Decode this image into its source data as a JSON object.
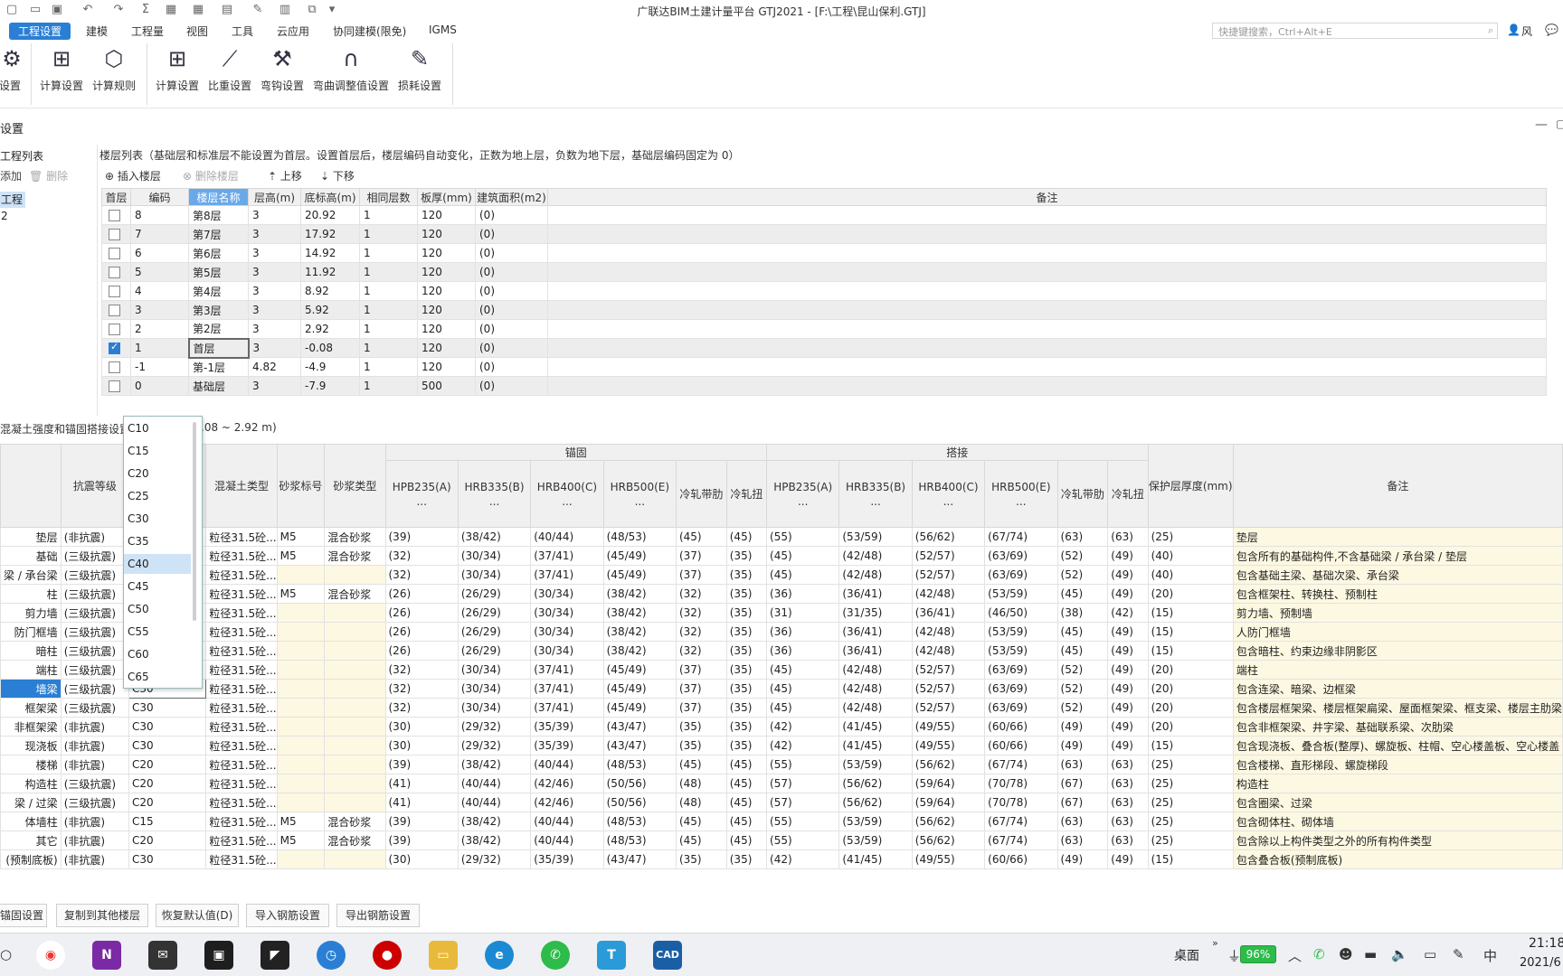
{
  "window": {
    "title": "广联达BIM土建计量平台 GTJ2021 - [F:\\工程\\昆山保利.GTJ]",
    "quick_search_placeholder": "快捷键搜索，Ctrl+Alt+E",
    "user": "风"
  },
  "menu": [
    "工程设置",
    "建模",
    "工程量",
    "视图",
    "工具",
    "云应用",
    "协同建模(限免)",
    "IGMS"
  ],
  "ribbon": {
    "left_partial": "设置",
    "calc_group": [
      "计算设置",
      "计算规则"
    ],
    "rebar_group": [
      "计算设置",
      "比重设置",
      "弯钩设置",
      "弯曲调整值设置",
      "损耗设置"
    ]
  },
  "dialog": {
    "title_partial": "设置"
  },
  "left_panel": {
    "label": "工程列表",
    "add": "添加",
    "delete": "删除",
    "item": "工程2"
  },
  "floor": {
    "caption": "楼层列表（基础层和标准层不能设置为首层。设置首层后，楼层编码自动变化，正数为地上层，负数为地下层，基础层编码固定为 0）",
    "tools": {
      "insert": "插入楼层",
      "delete": "删除楼层",
      "up": "上移",
      "down": "下移"
    },
    "headers": [
      "首层",
      "编码",
      "楼层名称",
      "层高(m)",
      "底标高(m)",
      "相同层数",
      "板厚(mm)",
      "建筑面积(m2)",
      "备注"
    ],
    "rows": [
      {
        "code": "8",
        "name": "第8层",
        "height": "3",
        "base": "20.92",
        "same": "1",
        "slab": "120",
        "area": "(0)",
        "first": false
      },
      {
        "code": "7",
        "name": "第7层",
        "height": "3",
        "base": "17.92",
        "same": "1",
        "slab": "120",
        "area": "(0)",
        "first": false
      },
      {
        "code": "6",
        "name": "第6层",
        "height": "3",
        "base": "14.92",
        "same": "1",
        "slab": "120",
        "area": "(0)",
        "first": false
      },
      {
        "code": "5",
        "name": "第5层",
        "height": "3",
        "base": "11.92",
        "same": "1",
        "slab": "120",
        "area": "(0)",
        "first": false
      },
      {
        "code": "4",
        "name": "第4层",
        "height": "3",
        "base": "8.92",
        "same": "1",
        "slab": "120",
        "area": "(0)",
        "first": false
      },
      {
        "code": "3",
        "name": "第3层",
        "height": "3",
        "base": "5.92",
        "same": "1",
        "slab": "120",
        "area": "(0)",
        "first": false
      },
      {
        "code": "2",
        "name": "第2层",
        "height": "3",
        "base": "2.92",
        "same": "1",
        "slab": "120",
        "area": "(0)",
        "first": false
      },
      {
        "code": "1",
        "name": "首层",
        "height": "3",
        "base": "-0.08",
        "same": "1",
        "slab": "120",
        "area": "(0)",
        "first": true
      },
      {
        "code": "-1",
        "name": "第-1层",
        "height": "4.82",
        "base": "-4.9",
        "same": "1",
        "slab": "120",
        "area": "(0)",
        "first": false
      },
      {
        "code": "0",
        "name": "基础层",
        "height": "3",
        "base": "-7.9",
        "same": "1",
        "slab": "500",
        "area": "(0)",
        "first": false
      }
    ]
  },
  "concrete": {
    "caption": "混凝土强度和锚固搭接设置",
    "range": ".08 ~ 2.92 m)",
    "group_anchor": "锚固",
    "group_lap": "搭接",
    "headers": {
      "seismic": "抗震等级",
      "conc_type": "混凝土类型",
      "mortar_grade": "砂浆标号",
      "mortar_type": "砂浆类型",
      "bars": [
        "HPB235(A)\n...",
        "HRB335(B)\n...",
        "HRB400(C)\n...",
        "HRB500(E)\n...",
        "冷轧带肋",
        "冷轧扭"
      ],
      "cover": "保护层厚度(mm)",
      "note": "备注"
    },
    "rows": [
      {
        "type": "垫层",
        "seismic": "(非抗震)",
        "grade": "",
        "ctype": "粒径31.5砼...",
        "mg": "M5",
        "mt": "混合砂浆",
        "anchor": [
          "(39)",
          "(38/42)",
          "(40/44)",
          "(48/53)",
          "(45)",
          "(45)"
        ],
        "lap": [
          "(55)",
          "(53/59)",
          "(56/62)",
          "(67/74)",
          "(63)",
          "(63)"
        ],
        "cover": "(25)",
        "note": "垫层"
      },
      {
        "type": "基础",
        "seismic": "(三级抗震)",
        "grade": "",
        "ctype": "粒径31.5砼...",
        "mg": "M5",
        "mt": "混合砂浆",
        "anchor": [
          "(32)",
          "(30/34)",
          "(37/41)",
          "(45/49)",
          "(37)",
          "(35)"
        ],
        "lap": [
          "(45)",
          "(42/48)",
          "(52/57)",
          "(63/69)",
          "(52)",
          "(49)"
        ],
        "cover": "(40)",
        "note": "包含所有的基础构件,不含基础梁 / 承台梁 / 垫层"
      },
      {
        "type": "梁 / 承台梁",
        "seismic": "(三级抗震)",
        "grade": "",
        "ctype": "粒径31.5砼...",
        "mg": "",
        "mt": "",
        "anchor": [
          "(32)",
          "(30/34)",
          "(37/41)",
          "(45/49)",
          "(37)",
          "(35)"
        ],
        "lap": [
          "(45)",
          "(42/48)",
          "(52/57)",
          "(63/69)",
          "(52)",
          "(49)"
        ],
        "cover": "(40)",
        "note": "包含基础主梁、基础次梁、承台梁"
      },
      {
        "type": "柱",
        "seismic": "(三级抗震)",
        "grade": "",
        "ctype": "粒径31.5砼...",
        "mg": "M5",
        "mt": "混合砂浆",
        "anchor": [
          "(26)",
          "(26/29)",
          "(30/34)",
          "(38/42)",
          "(32)",
          "(35)"
        ],
        "lap": [
          "(36)",
          "(36/41)",
          "(42/48)",
          "(53/59)",
          "(45)",
          "(49)"
        ],
        "cover": "(20)",
        "note": "包含框架柱、转换柱、预制柱"
      },
      {
        "type": "剪力墙",
        "seismic": "(三级抗震)",
        "grade": "",
        "ctype": "粒径31.5砼...",
        "mg": "",
        "mt": "",
        "anchor": [
          "(26)",
          "(26/29)",
          "(30/34)",
          "(38/42)",
          "(32)",
          "(35)"
        ],
        "lap": [
          "(31)",
          "(31/35)",
          "(36/41)",
          "(46/50)",
          "(38)",
          "(42)"
        ],
        "cover": "(15)",
        "note": "剪力墙、预制墙"
      },
      {
        "type": "防门框墙",
        "seismic": "(三级抗震)",
        "grade": "",
        "ctype": "粒径31.5砼...",
        "mg": "",
        "mt": "",
        "anchor": [
          "(26)",
          "(26/29)",
          "(30/34)",
          "(38/42)",
          "(32)",
          "(35)"
        ],
        "lap": [
          "(36)",
          "(36/41)",
          "(42/48)",
          "(53/59)",
          "(45)",
          "(49)"
        ],
        "cover": "(15)",
        "note": "人防门框墙"
      },
      {
        "type": "暗柱",
        "seismic": "(三级抗震)",
        "grade": "",
        "ctype": "粒径31.5砼...",
        "mg": "",
        "mt": "",
        "anchor": [
          "(26)",
          "(26/29)",
          "(30/34)",
          "(38/42)",
          "(32)",
          "(35)"
        ],
        "lap": [
          "(36)",
          "(36/41)",
          "(42/48)",
          "(53/59)",
          "(45)",
          "(49)"
        ],
        "cover": "(15)",
        "note": "包含暗柱、约束边缘非阴影区"
      },
      {
        "type": "端柱",
        "seismic": "(三级抗震)",
        "grade": "",
        "ctype": "粒径31.5砼...",
        "mg": "",
        "mt": "",
        "anchor": [
          "(32)",
          "(30/34)",
          "(37/41)",
          "(45/49)",
          "(37)",
          "(35)"
        ],
        "lap": [
          "(45)",
          "(42/48)",
          "(52/57)",
          "(63/69)",
          "(52)",
          "(49)"
        ],
        "cover": "(20)",
        "note": "端柱"
      },
      {
        "type": "墙梁",
        "seismic": "(三级抗震)",
        "grade": "C30",
        "ctype": "粒径31.5砼...",
        "mg": "",
        "mt": "",
        "anchor": [
          "(32)",
          "(30/34)",
          "(37/41)",
          "(45/49)",
          "(37)",
          "(35)"
        ],
        "lap": [
          "(45)",
          "(42/48)",
          "(52/57)",
          "(63/69)",
          "(52)",
          "(49)"
        ],
        "cover": "(20)",
        "note": "包含连梁、暗梁、边框梁"
      },
      {
        "type": "框架梁",
        "seismic": "(三级抗震)",
        "grade": "C30",
        "ctype": "粒径31.5砼...",
        "mg": "",
        "mt": "",
        "anchor": [
          "(32)",
          "(30/34)",
          "(37/41)",
          "(45/49)",
          "(37)",
          "(35)"
        ],
        "lap": [
          "(45)",
          "(42/48)",
          "(52/57)",
          "(63/69)",
          "(52)",
          "(49)"
        ],
        "cover": "(20)",
        "note": "包含楼层框架梁、楼层框架扁梁、屋面框架梁、框支梁、楼层主肋梁"
      },
      {
        "type": "非框架梁",
        "seismic": "(非抗震)",
        "grade": "C30",
        "ctype": "粒径31.5砼...",
        "mg": "",
        "mt": "",
        "anchor": [
          "(30)",
          "(29/32)",
          "(35/39)",
          "(43/47)",
          "(35)",
          "(35)"
        ],
        "lap": [
          "(42)",
          "(41/45)",
          "(49/55)",
          "(60/66)",
          "(49)",
          "(49)"
        ],
        "cover": "(20)",
        "note": "包含非框架梁、井字梁、基础联系梁、次肋梁"
      },
      {
        "type": "现浇板",
        "seismic": "(非抗震)",
        "grade": "C30",
        "ctype": "粒径31.5砼...",
        "mg": "",
        "mt": "",
        "anchor": [
          "(30)",
          "(29/32)",
          "(35/39)",
          "(43/47)",
          "(35)",
          "(35)"
        ],
        "lap": [
          "(42)",
          "(41/45)",
          "(49/55)",
          "(60/66)",
          "(49)",
          "(49)"
        ],
        "cover": "(15)",
        "note": "包含现浇板、叠合板(整厚)、螺旋板、柱帽、空心楼盖板、空心楼盖"
      },
      {
        "type": "楼梯",
        "seismic": "(非抗震)",
        "grade": "C20",
        "ctype": "粒径31.5砼...",
        "mg": "",
        "mt": "",
        "anchor": [
          "(39)",
          "(38/42)",
          "(40/44)",
          "(48/53)",
          "(45)",
          "(45)"
        ],
        "lap": [
          "(55)",
          "(53/59)",
          "(56/62)",
          "(67/74)",
          "(63)",
          "(63)"
        ],
        "cover": "(25)",
        "note": "包含楼梯、直形梯段、螺旋梯段"
      },
      {
        "type": "构造柱",
        "seismic": "(三级抗震)",
        "grade": "C20",
        "ctype": "粒径31.5砼...",
        "mg": "",
        "mt": "",
        "anchor": [
          "(41)",
          "(40/44)",
          "(42/46)",
          "(50/56)",
          "(48)",
          "(45)"
        ],
        "lap": [
          "(57)",
          "(56/62)",
          "(59/64)",
          "(70/78)",
          "(67)",
          "(63)"
        ],
        "cover": "(25)",
        "note": "构造柱"
      },
      {
        "type": "梁 / 过梁",
        "seismic": "(三级抗震)",
        "grade": "C20",
        "ctype": "粒径31.5砼...",
        "mg": "",
        "mt": "",
        "anchor": [
          "(41)",
          "(40/44)",
          "(42/46)",
          "(50/56)",
          "(48)",
          "(45)"
        ],
        "lap": [
          "(57)",
          "(56/62)",
          "(59/64)",
          "(70/78)",
          "(67)",
          "(63)"
        ],
        "cover": "(25)",
        "note": "包含圈梁、过梁"
      },
      {
        "type": "体墙柱",
        "seismic": "(非抗震)",
        "grade": "C15",
        "ctype": "粒径31.5砼...",
        "mg": "M5",
        "mt": "混合砂浆",
        "anchor": [
          "(39)",
          "(38/42)",
          "(40/44)",
          "(48/53)",
          "(45)",
          "(45)"
        ],
        "lap": [
          "(55)",
          "(53/59)",
          "(56/62)",
          "(67/74)",
          "(63)",
          "(63)"
        ],
        "cover": "(25)",
        "note": "包含砌体柱、砌体墙"
      },
      {
        "type": "其它",
        "seismic": "(非抗震)",
        "grade": "C20",
        "ctype": "粒径31.5砼...",
        "mg": "M5",
        "mt": "混合砂浆",
        "anchor": [
          "(39)",
          "(38/42)",
          "(40/44)",
          "(48/53)",
          "(45)",
          "(45)"
        ],
        "lap": [
          "(55)",
          "(53/59)",
          "(56/62)",
          "(67/74)",
          "(63)",
          "(63)"
        ],
        "cover": "(25)",
        "note": "包含除以上构件类型之外的所有构件类型"
      },
      {
        "type": "(预制底板)",
        "seismic": "(非抗震)",
        "grade": "C30",
        "ctype": "粒径31.5砼...",
        "mg": "",
        "mt": "",
        "anchor": [
          "(30)",
          "(29/32)",
          "(35/39)",
          "(43/47)",
          "(35)",
          "(35)"
        ],
        "lap": [
          "(42)",
          "(41/45)",
          "(49/55)",
          "(60/66)",
          "(49)",
          "(49)"
        ],
        "cover": "(15)",
        "note": "包含叠合板(预制底板)"
      }
    ],
    "dropdown_options": [
      "C10",
      "C15",
      "C20",
      "C25",
      "C30",
      "C35",
      "C40",
      "C45",
      "C50",
      "C55",
      "C60",
      "C65"
    ],
    "dropdown_selected": "C40",
    "editing_value": "C30"
  },
  "buttons": [
    "锚固设置",
    "复制到其他楼层",
    "恢复默认值(D)",
    "导入钢筋设置",
    "导出钢筋设置"
  ],
  "taskbar": {
    "desktop": "桌面",
    "battery": "96%",
    "ime": "中",
    "time": "21:18",
    "date": "2021/6"
  },
  "colors": {
    "accent": "#2a7fd4",
    "editable_yellow": "#fdf8e1"
  }
}
